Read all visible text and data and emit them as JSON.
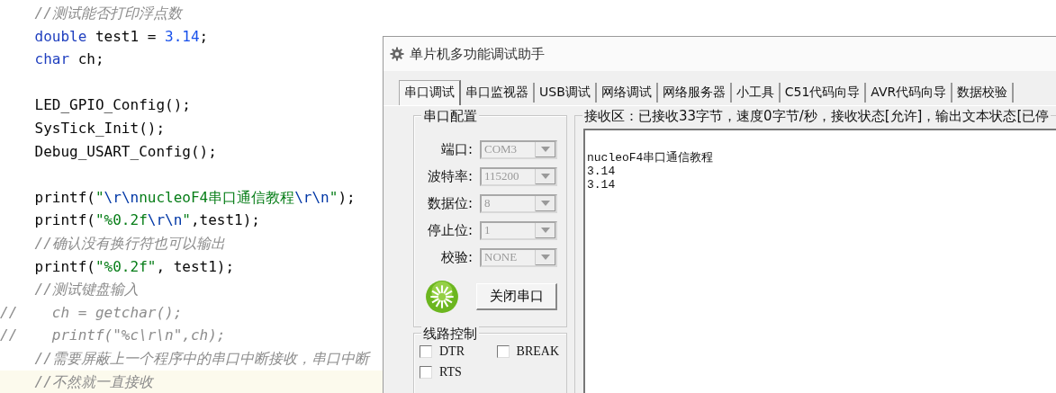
{
  "editor": {
    "lines": [
      {
        "kind": "code",
        "segments": [
          {
            "kind": "comment",
            "text": "    //测试能否打印浮点数"
          }
        ]
      },
      {
        "kind": "code",
        "segments": [
          {
            "kind": "keyword",
            "text": "    double"
          },
          {
            "kind": "plain",
            "text": " test1 = "
          },
          {
            "kind": "number",
            "text": "3.14"
          },
          {
            "kind": "plain",
            "text": ";"
          }
        ]
      },
      {
        "kind": "code",
        "segments": [
          {
            "kind": "keyword",
            "text": "    char"
          },
          {
            "kind": "plain",
            "text": " ch;"
          }
        ]
      },
      {
        "kind": "blank"
      },
      {
        "kind": "code",
        "segments": [
          {
            "kind": "plain",
            "text": "    LED_GPIO_Config();"
          }
        ]
      },
      {
        "kind": "code",
        "segments": [
          {
            "kind": "plain",
            "text": "    SysTick_Init();"
          }
        ]
      },
      {
        "kind": "code",
        "segments": [
          {
            "kind": "plain",
            "text": "    Debug_USART_Config();"
          }
        ]
      },
      {
        "kind": "blank"
      },
      {
        "kind": "code",
        "segments": [
          {
            "kind": "plain",
            "text": "    printf("
          },
          {
            "kind": "string",
            "text": "\""
          },
          {
            "kind": "escape",
            "text": "\\r\\n"
          },
          {
            "kind": "string",
            "text": "nucleoF4串口通信教程"
          },
          {
            "kind": "escape",
            "text": "\\r\\n"
          },
          {
            "kind": "string",
            "text": "\""
          },
          {
            "kind": "plain",
            "text": ");"
          }
        ]
      },
      {
        "kind": "code",
        "segments": [
          {
            "kind": "plain",
            "text": "    printf("
          },
          {
            "kind": "string",
            "text": "\"%0.2f"
          },
          {
            "kind": "escape",
            "text": "\\r\\n"
          },
          {
            "kind": "string",
            "text": "\""
          },
          {
            "kind": "plain",
            "text": ",test1);"
          }
        ]
      },
      {
        "kind": "code",
        "segments": [
          {
            "kind": "comment",
            "text": "    //确认没有换行符也可以输出"
          }
        ]
      },
      {
        "kind": "code",
        "segments": [
          {
            "kind": "plain",
            "text": "    printf("
          },
          {
            "kind": "string",
            "text": "\"%0.2f\""
          },
          {
            "kind": "plain",
            "text": ", test1);"
          }
        ]
      },
      {
        "kind": "code",
        "segments": [
          {
            "kind": "comment",
            "text": "    //测试键盘输入"
          }
        ]
      },
      {
        "kind": "code",
        "segments": [
          {
            "kind": "comment",
            "text": "//    ch = getchar();"
          }
        ]
      },
      {
        "kind": "code",
        "segments": [
          {
            "kind": "comment",
            "text": "//    printf(\"%c\\r\\n\",ch);"
          }
        ]
      },
      {
        "kind": "code",
        "segments": [
          {
            "kind": "comment",
            "text": "    //需要屏蔽上一个程序中的串口中断接收，串口中断"
          }
        ]
      },
      {
        "kind": "current",
        "segments": [
          {
            "kind": "comment",
            "text": "    //不然就一直接收"
          }
        ]
      }
    ]
  },
  "window": {
    "title": "单片机多功能调试助手",
    "tabs": [
      {
        "label": "串口调试",
        "selected": true
      },
      {
        "label": "串口监视器",
        "selected": false
      },
      {
        "label": "USB调试",
        "selected": false
      },
      {
        "label": "网络调试",
        "selected": false
      },
      {
        "label": "网络服务器",
        "selected": false
      },
      {
        "label": "小工具",
        "selected": false
      },
      {
        "label": "C51代码向导",
        "selected": false
      },
      {
        "label": "AVR代码向导",
        "selected": false
      },
      {
        "label": "数据校验",
        "selected": false
      }
    ],
    "serial_config": {
      "title": "串口配置",
      "fields": [
        {
          "label": "端口:",
          "value": "COM3",
          "disabled": true
        },
        {
          "label": "波特率:",
          "value": "115200",
          "disabled": true
        },
        {
          "label": "数据位:",
          "value": "8",
          "disabled": true
        },
        {
          "label": "停止位:",
          "value": "1",
          "disabled": true
        },
        {
          "label": "校验:",
          "value": "NONE",
          "disabled": true
        }
      ],
      "port_open": true,
      "button": "关闭串口"
    },
    "line_control": {
      "title": "线路控制",
      "checkboxes": [
        {
          "label": "DTR",
          "checked": false
        },
        {
          "label": "BREAK",
          "checked": false
        },
        {
          "label": "RTS",
          "checked": false
        }
      ]
    },
    "receive": {
      "status": "接收区：已接收33字节，速度0字节/秒，接收状态[允许]，输出文本状态[已停",
      "lines": [
        "nucleoF4串口通信教程",
        "3.14",
        "3.14"
      ]
    }
  }
}
